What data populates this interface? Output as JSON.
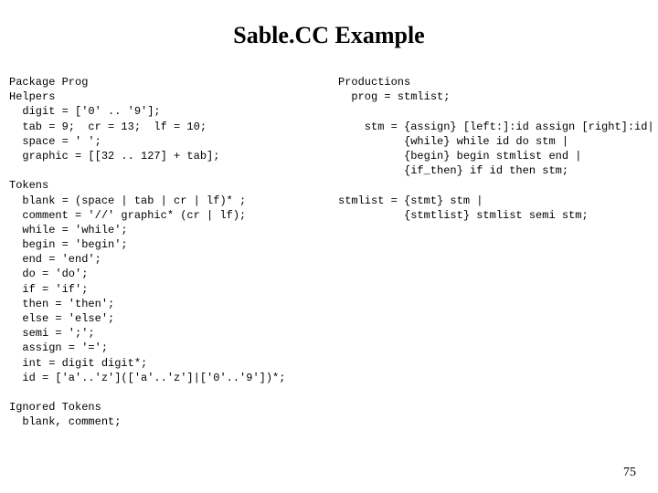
{
  "title": "Sable.CC Example",
  "page_number": "75",
  "left": {
    "l01": "Package Prog",
    "l02": "Helpers",
    "l03": "  digit = ['0' .. '9'];",
    "l04": "  tab = 9;  cr = 13;  lf = 10;",
    "l05": "  space = ' ';",
    "l06": "  graphic = [[32 .. 127] + tab];",
    "l07": "",
    "l08": "Tokens",
    "l09": "  blank = (space | tab | cr | lf)* ;",
    "l10": "  comment = '//' graphic* (cr | lf);",
    "l11": "  while = 'while';",
    "l12": "  begin = 'begin';",
    "l13": "  end = 'end';",
    "l14": "  do = 'do';",
    "l15": "  if = 'if';",
    "l16": "  then = 'then';",
    "l17": "  else = 'else';",
    "l18": "  semi = ';';",
    "l19": "  assign = '=';",
    "l20": "  int = digit digit*;",
    "l21": "  id = ['a'..'z'](['a'..'z']|['0'..'9'])*;",
    "l22": "",
    "l23": "Ignored Tokens",
    "l24": "  blank, comment;"
  },
  "right": {
    "r01": "Productions",
    "r02": "  prog = stmlist;",
    "r03": "",
    "r04": "    stm = {assign} [left:]:id assign [right]:id|",
    "r05": "          {while} while id do stm |",
    "r06": "          {begin} begin stmlist end |",
    "r07": "          {if_then} if id then stm;",
    "r08": "",
    "r09": "stmlist = {stmt} stm |",
    "r10": "          {stmtlist} stmlist semi stm;"
  }
}
